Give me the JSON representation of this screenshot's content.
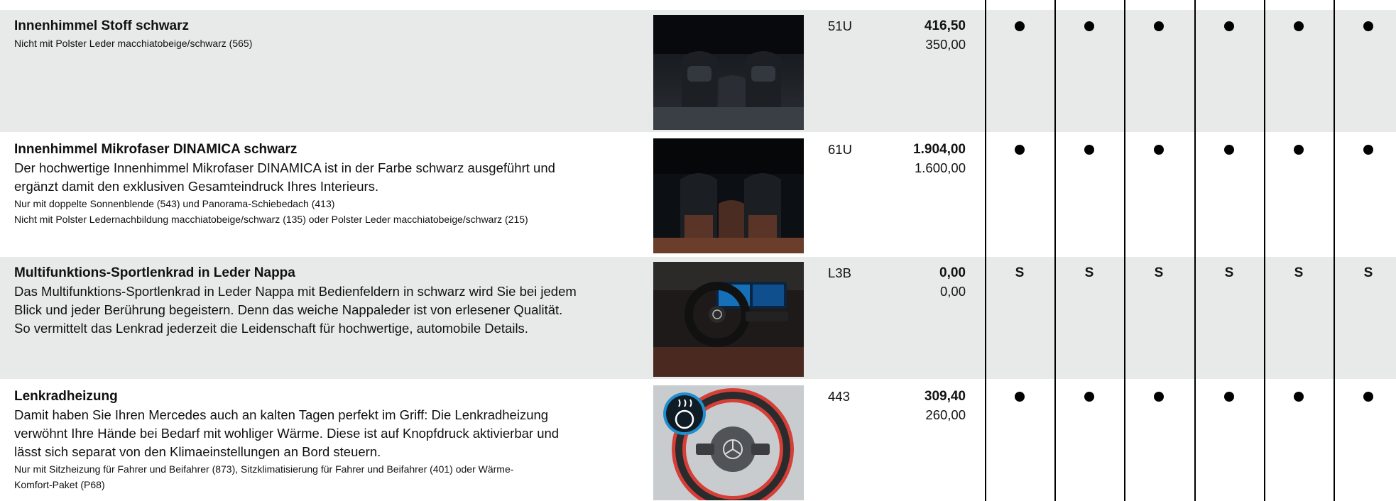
{
  "columns": {
    "dot_symbol": "●"
  },
  "rows": [
    {
      "title": "Innenhimmel Stoff schwarz",
      "body": [],
      "notes": [
        "Nicht mit Polster Leder macchiatobeige/schwarz (565)"
      ],
      "code": "51U",
      "price_gross": "416,50",
      "price_net": "350,00",
      "marks": [
        "dot",
        "dot",
        "dot",
        "dot",
        "dot",
        "dot"
      ],
      "image": "interior-rear-seats-black-headliner-photo"
    },
    {
      "title": "Innenhimmel Mikrofaser DINAMICA schwarz",
      "body": [
        "Der hochwertige Innenhimmel Mikrofaser DINAMICA ist in der Farbe schwarz ausgeführt und",
        "ergänzt damit den exklusiven Gesamteindruck Ihres Interieurs."
      ],
      "notes": [
        "Nur mit doppelte Sonnenblende (543) und Panorama-Schiebedach (413)",
        "Nicht mit Polster Ledernachbildung macchiatobeige/schwarz (135) oder Polster Leder macchiatobeige/schwarz (215)"
      ],
      "code": "61U",
      "price_gross": "1.904,00",
      "price_net": "1.600,00",
      "marks": [
        "dot",
        "dot",
        "dot",
        "dot",
        "dot",
        "dot"
      ],
      "image": "interior-rear-seats-brown-leather-photo"
    },
    {
      "title": "Multifunktions-Sportlenkrad in Leder Nappa",
      "body": [
        "Das Multifunktions-Sportlenkrad in Leder Nappa mit Bedienfeldern in schwarz wird Sie bei jedem",
        "Blick und jeder Berührung begeistern. Denn das weiche Nappaleder ist von erlesener Qualität.",
        "So vermittelt das Lenkrad jederzeit die Leidenschaft für hochwertige, automobile Details."
      ],
      "notes": [],
      "code": "L3B",
      "price_gross": "0,00",
      "price_net": "0,00",
      "marks": [
        "S",
        "S",
        "S",
        "S",
        "S",
        "S"
      ],
      "image": "cockpit-steering-wheel-photo"
    },
    {
      "title": "Lenkradheizung",
      "body": [
        "Damit haben Sie Ihren Mercedes auch an kalten Tagen perfekt im Griff: Die Lenkradheizung",
        "verwöhnt Ihre Hände bei Bedarf mit wohliger Wärme. Diese ist auf Knopfdruck aktivierbar und",
        "lässt sich separat von den Klimaeinstellungen an Bord steuern."
      ],
      "notes": [
        "Nur mit Sitzheizung für Fahrer und Beifahrer (873), Sitzklimatisierung für Fahrer und Beifahrer (401) oder Wärme-",
        "Komfort-Paket (P68)"
      ],
      "code": "443",
      "price_gross": "309,40",
      "price_net": "260,00",
      "marks": [
        "dot",
        "dot",
        "dot",
        "dot",
        "dot",
        "dot"
      ],
      "image": "heated-steering-wheel-photo"
    }
  ],
  "colors": {
    "row_shade": "#e8e9e9",
    "heat_ring": "#d8261c",
    "icon_circle": "#1f8fd0"
  }
}
